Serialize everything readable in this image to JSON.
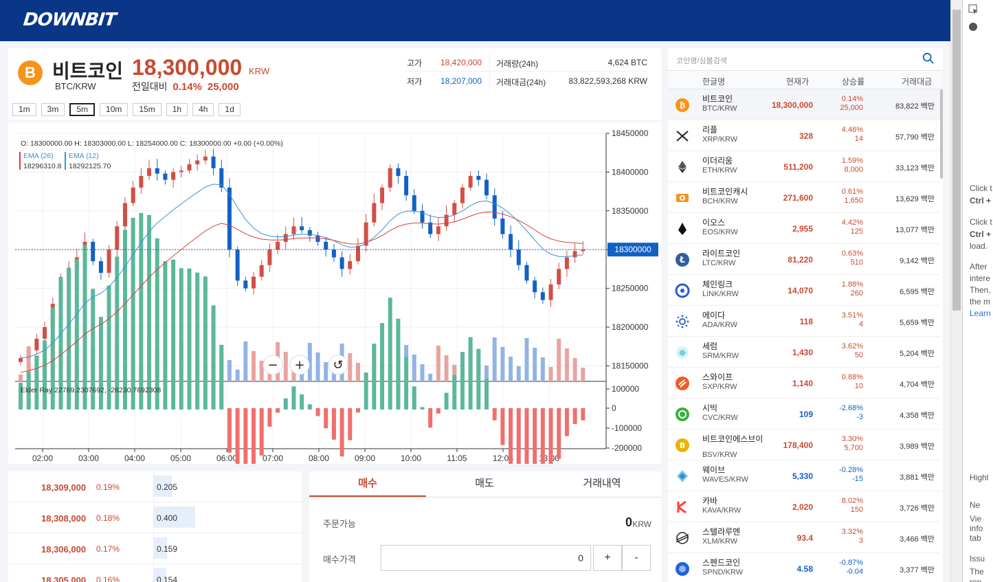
{
  "app": {
    "logo": "DOWNBIT"
  },
  "coin": {
    "icon_letter": "B",
    "name": "비트코인",
    "price": "18,300,000",
    "unit": "KRW",
    "pair": "BTC/KRW",
    "prev_label": "전일대비",
    "change_pct": "0.14%",
    "change_amt": "25,000"
  },
  "stats": {
    "high_label": "고가",
    "high": "18,420,000",
    "low_label": "저가",
    "low": "18,207,000",
    "vol_label": "거래량(24h)",
    "vol": "4,624 BTC",
    "amount_label": "거래대금(24h)",
    "amount": "83,822,593,268 KRW"
  },
  "timeframes": [
    "1m",
    "3m",
    "5m",
    "10m",
    "15m",
    "1h",
    "4h",
    "1d"
  ],
  "active_timeframe": "5m",
  "chart_data": {
    "type": "candlestick",
    "ohlc_label": "O: 18300000.00 H: 18303000.00 L: 18254000.00 C: 18300000.00 +0.00 (+0.00%)",
    "ema26_label": "EMA (26)",
    "ema26_value": "18296310.8",
    "ema12_label": "EMA (12)",
    "ema12_value": "18292125.70",
    "yticks": [
      "18450000",
      "18400000",
      "18350000",
      "18300000",
      "18250000",
      "18200000",
      "18150000"
    ],
    "current_price_label": "18300000",
    "ylim": [
      18130000,
      18450000
    ],
    "elder_label": "Elder Ray 22769.2307692, -26230.7692308",
    "elder_yticks": [
      "100000",
      "0",
      "-100000",
      "-200000"
    ],
    "xticks": [
      "02:00",
      "03:00",
      "04:00",
      "05:00",
      "06:00",
      "07:00",
      "08:00",
      "09:00",
      "10:00",
      "11:05",
      "12:05",
      "13:00"
    ],
    "close_series": [
      18160000,
      18170000,
      18185000,
      18200000,
      18230000,
      18260000,
      18275000,
      18290000,
      18310000,
      18285000,
      18270000,
      18300000,
      18330000,
      18360000,
      18380000,
      18395000,
      18405000,
      18398000,
      18390000,
      18400000,
      18402000,
      18410000,
      18415000,
      18420000,
      18405000,
      18380000,
      18300000,
      18260000,
      18250000,
      18265000,
      18280000,
      18300000,
      18310000,
      18320000,
      18330000,
      18325000,
      18318000,
      18310000,
      18300000,
      18290000,
      18275000,
      18285000,
      18305000,
      18335000,
      18360000,
      18380000,
      18405000,
      18395000,
      18370000,
      18350000,
      18335000,
      18320000,
      18330000,
      18345000,
      18360000,
      18380000,
      18395000,
      18390000,
      18370000,
      18340000,
      18320000,
      18300000,
      18280000,
      18260000,
      18245000,
      18235000,
      18255000,
      18275000,
      18290000,
      18298000,
      18300000
    ]
  },
  "zoom_controls": {
    "minus": "−",
    "plus": "+",
    "reset": "↺"
  },
  "orderbook": [
    {
      "price": "18,309,000",
      "pct": "0.19%",
      "qty": "0.205",
      "fill": 0.22
    },
    {
      "price": "18,308,000",
      "pct": "0.18%",
      "qty": "0.400",
      "fill": 0.5
    },
    {
      "price": "18,306,000",
      "pct": "0.17%",
      "qty": "0.159",
      "fill": 0.16
    },
    {
      "price": "18,305,000",
      "pct": "0.16%",
      "qty": "0.154",
      "fill": 0.15
    }
  ],
  "orderform": {
    "tabs": [
      "매수",
      "매도",
      "거래내역"
    ],
    "available_label": "주문가능",
    "available_value": "0",
    "available_unit": "KRW",
    "price_label": "매수가격",
    "price_value": "0",
    "plus": "+",
    "minus": "-"
  },
  "market": {
    "search_placeholder": "코인명/심볼검색",
    "headers": [
      "한글명",
      "현재가",
      "상승률",
      "거래대금"
    ],
    "rows": [
      {
        "name": "비트코인",
        "pair": "BTC/KRW",
        "price": "18,300,000",
        "pct": "0.14%",
        "chg": "25,000",
        "vol": "83,822 백만",
        "dir": "r",
        "icon": "btc"
      },
      {
        "name": "리플",
        "pair": "XRP/KRW",
        "price": "328",
        "pct": "4.46%",
        "chg": "14",
        "vol": "57,790 백만",
        "dir": "r",
        "icon": "xrp"
      },
      {
        "name": "이더리움",
        "pair": "ETH/KRW",
        "price": "511,200",
        "pct": "1.59%",
        "chg": "8,000",
        "vol": "33,123 백만",
        "dir": "r",
        "icon": "eth"
      },
      {
        "name": "비트코인캐시",
        "pair": "BCH/KRW",
        "price": "271,600",
        "pct": "0.61%",
        "chg": "1,650",
        "vol": "13,629 백만",
        "dir": "r",
        "icon": "bch"
      },
      {
        "name": "이오스",
        "pair": "EOS/KRW",
        "price": "2,955",
        "pct": "4.42%",
        "chg": "125",
        "vol": "13,077 백만",
        "dir": "r",
        "icon": "eos"
      },
      {
        "name": "라이트코인",
        "pair": "LTC/KRW",
        "price": "81,220",
        "pct": "0.63%",
        "chg": "510",
        "vol": "9,142 백만",
        "dir": "r",
        "icon": "ltc"
      },
      {
        "name": "체인링크",
        "pair": "LINK/KRW",
        "price": "14,070",
        "pct": "1.88%",
        "chg": "260",
        "vol": "6,595 백만",
        "dir": "r",
        "icon": "link"
      },
      {
        "name": "에이다",
        "pair": "ADA/KRW",
        "price": "118",
        "pct": "3.51%",
        "chg": "4",
        "vol": "5,659 백만",
        "dir": "r",
        "icon": "ada"
      },
      {
        "name": "세럼",
        "pair": "SRM/KRW",
        "price": "1,430",
        "pct": "3.62%",
        "chg": "50",
        "vol": "5,204 백만",
        "dir": "r",
        "icon": "srm"
      },
      {
        "name": "스와이프",
        "pair": "SXP/KRW",
        "price": "1,140",
        "pct": "0.88%",
        "chg": "10",
        "vol": "4,704 백만",
        "dir": "r",
        "icon": "sxp"
      },
      {
        "name": "시빅",
        "pair": "CVC/KRW",
        "price": "109",
        "pct": "-2.68%",
        "chg": "-3",
        "vol": "4,358 백만",
        "dir": "b",
        "icon": "cvc"
      },
      {
        "name": "비트코인에스브이",
        "pair": "BSV/KRW",
        "price": "178,400",
        "pct": "3.30%",
        "chg": "5,700",
        "vol": "3,989 백만",
        "dir": "r",
        "icon": "bsv"
      },
      {
        "name": "웨이브",
        "pair": "WAVES/KRW",
        "price": "5,330",
        "pct": "-0.28%",
        "chg": "-15",
        "vol": "3,881 백만",
        "dir": "b",
        "icon": "waves"
      },
      {
        "name": "카바",
        "pair": "KAVA/KRW",
        "price": "2,020",
        "pct": "8.02%",
        "chg": "150",
        "vol": "3,726 백만",
        "dir": "r",
        "icon": "kava"
      },
      {
        "name": "스텔라루멘",
        "pair": "XLM/KRW",
        "price": "93.4",
        "pct": "3.32%",
        "chg": "3",
        "vol": "3,466 백만",
        "dir": "r",
        "icon": "xlm"
      },
      {
        "name": "스펜드코인",
        "pair": "SPND/KRW",
        "price": "4.58",
        "pct": "-0.87%",
        "chg": "-0.04",
        "vol": "3,377 백만",
        "dir": "b",
        "icon": "spnd"
      }
    ]
  },
  "devtools": {
    "lines": [
      "Click t",
      "Ctrl +",
      "Click t",
      "Ctrl +",
      "load.",
      "After",
      "intere",
      "Then,",
      "the m",
      "Learn",
      "Highl",
      "Ne",
      "Vie",
      "info",
      "tab",
      "Issu",
      "The",
      "rep"
    ]
  }
}
